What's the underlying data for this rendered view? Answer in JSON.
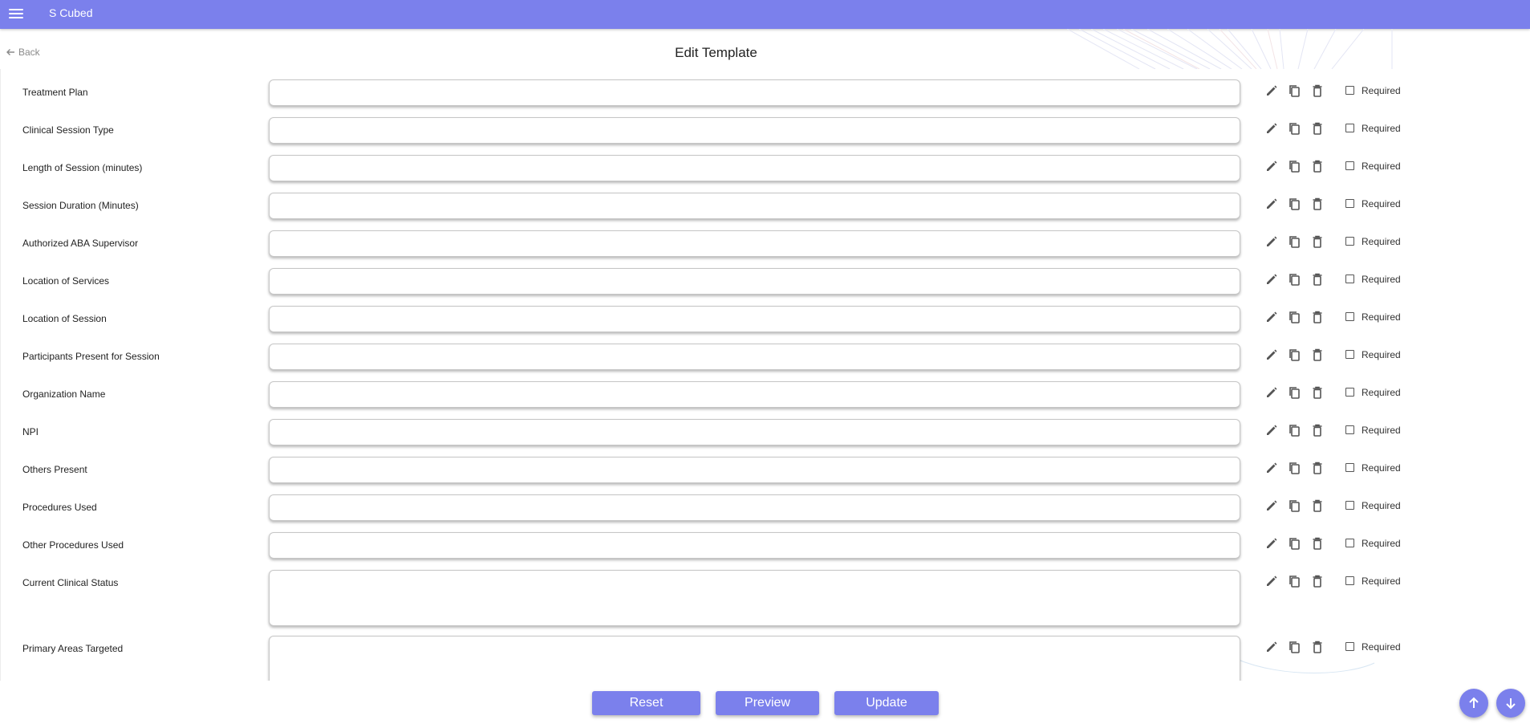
{
  "app": {
    "title": "S Cubed"
  },
  "header": {
    "back_label": "Back",
    "title": "Edit Template"
  },
  "fields": [
    {
      "label": "Treatment Plan",
      "required_label": "Required",
      "required": false
    },
    {
      "label": "Clinical Session Type",
      "required_label": "Required",
      "required": false
    },
    {
      "label": "Length of Session (minutes)",
      "required_label": "Required",
      "required": false
    },
    {
      "label": "Session Duration (Minutes)",
      "required_label": "Required",
      "required": false
    },
    {
      "label": "Authorized ABA Supervisor",
      "required_label": "Required",
      "required": false
    },
    {
      "label": "Location of Services",
      "required_label": "Required",
      "required": false
    },
    {
      "label": "Location of Session",
      "required_label": "Required",
      "required": false
    },
    {
      "label": "Participants Present for Session",
      "required_label": "Required",
      "required": false
    },
    {
      "label": "Organization Name",
      "required_label": "Required",
      "required": false
    },
    {
      "label": "NPI",
      "required_label": "Required",
      "required": false
    },
    {
      "label": "Others Present",
      "required_label": "Required",
      "required": false
    },
    {
      "label": "Procedures Used",
      "required_label": "Required",
      "required": false
    },
    {
      "label": "Other Procedures Used",
      "required_label": "Required",
      "required": false
    },
    {
      "label": "Current Clinical Status",
      "required_label": "Required",
      "required": false
    },
    {
      "label": "Primary Areas Targeted",
      "required_label": "Required",
      "required": false
    }
  ],
  "footer": {
    "reset_label": "Reset",
    "preview_label": "Preview",
    "update_label": "Update"
  },
  "colors": {
    "accent": "#7b80ec",
    "icon": "#555555"
  }
}
